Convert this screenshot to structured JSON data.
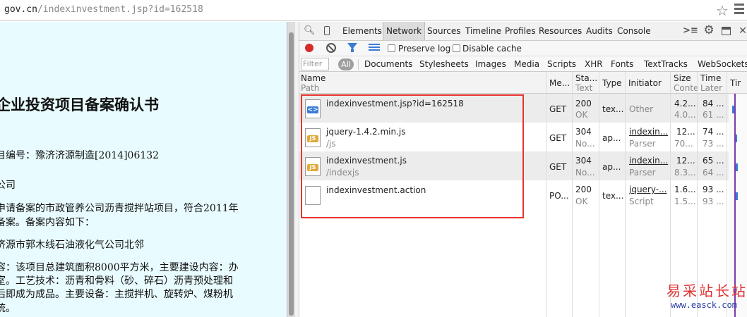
{
  "address": {
    "host": "gov.cn",
    "path": "/indexinvestment.jsp?id=162518"
  },
  "page": {
    "title": "企业投资项目备案确认书",
    "lines": [
      "目编号：豫济济源制造[2014]06132",
      "公司",
      "申请备案的市政管养公司沥青搅拌站项目，符合2011年",
      "备案。备案内容如下：",
      "济源市郭木线石油液化气公司北邻",
      "容：该项目总建筑面积8000平方米，主要建设内容：办",
      "室。工艺技术：沥青和骨料（砂、碎石）沥青预处理和",
      "后即成为成品。主要设备：主搅拌机、旋转炉、煤粉机",
      "统。"
    ]
  },
  "devtools": {
    "tabs": [
      "Elements",
      "Network",
      "Sources",
      "Timeline",
      "Profiles",
      "Resources",
      "Audits",
      "Console"
    ],
    "selected_tab": "Network",
    "preserve_log": "Preserve log",
    "disable_cache": "Disable cache",
    "filter_placeholder": "Filter",
    "all_label": "All",
    "filter_types": [
      "Documents",
      "Stylesheets",
      "Images",
      "Media",
      "Scripts",
      "XHR",
      "Fonts",
      "TextTracks",
      "WebSockets"
    ],
    "columns": {
      "name": "Name",
      "path": "Path",
      "method": "Me...",
      "status": "Sta...",
      "text": "Text",
      "type": "Type",
      "initiator": "Initiator",
      "size": "Size",
      "content": "Conte",
      "time": "Time",
      "latency": "Later",
      "timeline": "Tir"
    },
    "rows": [
      {
        "name": "indexinvestment.jsp?id=162518",
        "path": "",
        "icon": "html-doc-icon",
        "method": "GET",
        "status": "200",
        "status_text": "OK",
        "type": "tex...",
        "initiator": "Other",
        "initiator2": "",
        "size": "4.2...",
        "size2": "4.0...",
        "time": "84 ...",
        "time2": "61 ..."
      },
      {
        "name": "jquery-1.4.2.min.js",
        "path": "/js",
        "icon": "js-file-icon",
        "method": "GET",
        "status": "304",
        "status_text": "No...",
        "type": "ap...",
        "initiator": "indexin...",
        "initiator2": "Parser",
        "size": "12...",
        "size2": "70...",
        "time": "74 ...",
        "time2": "73 ..."
      },
      {
        "name": "indexinvestment.js",
        "path": "/indexjs",
        "icon": "js-file-icon",
        "method": "GET",
        "status": "304",
        "status_text": "No...",
        "type": "ap...",
        "initiator": "indexin...",
        "initiator2": "Parser",
        "size": "12...",
        "size2": "8.3...",
        "time": "65 ...",
        "time2": "64 ..."
      },
      {
        "name": "indexinvestment.action",
        "path": "",
        "icon": "blank-file-icon",
        "method": "PO...",
        "status": "200",
        "status_text": "OK",
        "type": "tex...",
        "initiator": "jquery-...",
        "initiator2": "Script",
        "size": "1.6...",
        "size2": "1.5...",
        "time": "93 ...",
        "time2": "93 ..."
      }
    ]
  },
  "watermark": {
    "cn": "易采站长站",
    "url": "www.easck.com"
  },
  "colors": {
    "highlight": "#e8332f",
    "record": "#d62b2b",
    "accent": "#3b7bd6",
    "page_bg": "#e8fbff"
  }
}
